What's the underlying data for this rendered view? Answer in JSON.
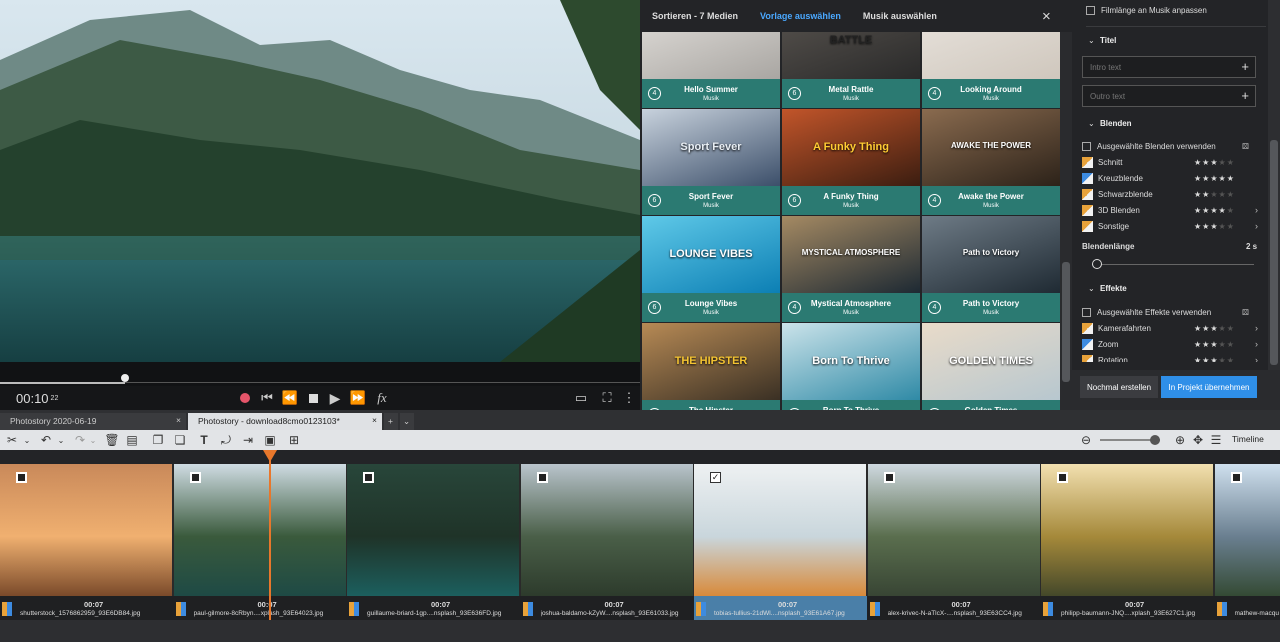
{
  "preview": {
    "timecode": "00:10",
    "frames": "22"
  },
  "templates": {
    "sort_label": "Sortieren - 7 Medien",
    "tab_templates": "Vorlage auswählen",
    "tab_music": "Musik auswählen",
    "close": "×",
    "tiles": [
      {
        "title": "Hello Summer",
        "sub": "Musik",
        "num": "4",
        "thumb_text": ""
      },
      {
        "title": "Metal Rattle",
        "sub": "Musik",
        "num": "6",
        "thumb_text": "BATTLE"
      },
      {
        "title": "Looking Around",
        "sub": "Musik",
        "num": "4",
        "thumb_text": ""
      },
      {
        "title": "Sport Fever",
        "sub": "Musik",
        "num": "6",
        "thumb_text": "Sport Fever"
      },
      {
        "title": "A Funky Thing",
        "sub": "Musik",
        "num": "6",
        "thumb_text": "A Funky Thing"
      },
      {
        "title": "Awake the Power",
        "sub": "Musik",
        "num": "4",
        "thumb_text": "AWAKE THE POWER"
      },
      {
        "title": "Lounge Vibes",
        "sub": "Musik",
        "num": "6",
        "thumb_text": "LOUNGE VIBES"
      },
      {
        "title": "Mystical Atmosphere",
        "sub": "Musik",
        "num": "4",
        "thumb_text": "MYSTICAL ATMOSPHERE"
      },
      {
        "title": "Path to Victory",
        "sub": "Musik",
        "num": "4",
        "thumb_text": "Path to Victory"
      },
      {
        "title": "The Hipster",
        "sub": "Musik",
        "num": "6",
        "thumb_text": "THE HIPSTER"
      },
      {
        "title": "Born To Thrive",
        "sub": "Musik",
        "num": "4",
        "thumb_text": "Born To Thrive"
      },
      {
        "title": "Golden Times",
        "sub": "Musik",
        "num": "4",
        "thumb_text": "GOLDEN TIMES"
      }
    ]
  },
  "side": {
    "fit_music": "Filmlänge an Musik anpassen",
    "titel": "Titel",
    "intro_placeholder": "Intro text",
    "outro_placeholder": "Outro text",
    "blenden": "Blenden",
    "use_selected_blends": "Ausgewählte Blenden verwenden",
    "blend_items": [
      {
        "label": "Schnitt",
        "stars": 3,
        "arrow": false,
        "color": "#e8a23a"
      },
      {
        "label": "Kreuzblende",
        "stars": 5,
        "arrow": false,
        "color": "#3d8be0"
      },
      {
        "label": "Schwarzblende",
        "stars": 2,
        "arrow": false,
        "color": "#e8a23a"
      },
      {
        "label": "3D Blenden",
        "stars": 4,
        "arrow": true,
        "color": "#e8a23a"
      },
      {
        "label": "Sonstige",
        "stars": 3,
        "arrow": true,
        "color": "#e8a23a"
      }
    ],
    "blend_length": "Blendenlänge",
    "blend_length_value": "2 s",
    "effekte": "Effekte",
    "use_selected_effects": "Ausgewählte Effekte verwenden",
    "effect_items": [
      {
        "label": "Kamerafahrten",
        "stars": 3,
        "arrow": true,
        "color": "#e8a23a"
      },
      {
        "label": "Zoom",
        "stars": 3,
        "arrow": true,
        "color": "#3d8be0"
      },
      {
        "label": "Rotation",
        "stars": 3,
        "arrow": true,
        "color": "#e8a23a"
      }
    ],
    "btn_again": "Nochmal erstellen",
    "btn_apply": "In Projekt übernehmen"
  },
  "tabs": {
    "tab1": "Photostory 2020-06-19",
    "tab2": "Photostory - download8cmo0123103*"
  },
  "toolbar": {
    "timeline": "Timeline"
  },
  "clips": [
    {
      "dur": "00:07",
      "file": "shutterstock_1576862959_93E6DB84.jpg",
      "checked": false
    },
    {
      "dur": "00:07",
      "file": "paul-gilmore-8cRbyn....xplash_93E64023.jpg",
      "checked": false
    },
    {
      "dur": "00:07",
      "file": "guillaume-briard-1gp....nsplash_93E636FD.jpg",
      "checked": false
    },
    {
      "dur": "00:07",
      "file": "joshua-baldamo-kZyW....nsplash_93E61033.jpg",
      "checked": false
    },
    {
      "dur": "00:07",
      "file": "tobias-tullius-21dWl....nsplash_93E61A67.jpg",
      "checked": true
    },
    {
      "dur": "00:07",
      "file": "alex-krivec-N-aTlcX-....nsplash_93E63CC4.jpg",
      "checked": false
    },
    {
      "dur": "00:07",
      "file": "philipp-baumann-JNQ....xplash_93E627C1.jpg",
      "checked": false
    },
    {
      "dur": "",
      "file": "mathew-macqu",
      "checked": false
    }
  ],
  "colors": {
    "accent": "#4aa8ff",
    "teal": "#2b7a72",
    "playhead": "#e8772b",
    "apply": "#2f8fe8"
  }
}
